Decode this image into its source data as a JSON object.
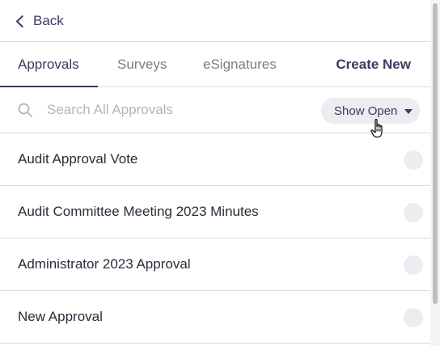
{
  "header": {
    "back_label": "Back"
  },
  "tabs": [
    {
      "label": "Approvals",
      "active": true
    },
    {
      "label": "Surveys",
      "active": false
    },
    {
      "label": "eSignatures",
      "active": false
    }
  ],
  "create_new_label": "Create New",
  "search": {
    "placeholder": "Search All Approvals",
    "value": ""
  },
  "filter": {
    "label": "Show Open"
  },
  "approvals": [
    {
      "title": "Audit Approval Vote"
    },
    {
      "title": "Audit Committee Meeting 2023 Minutes"
    },
    {
      "title": "Administrator 2023 Approval"
    },
    {
      "title": "New Approval"
    }
  ],
  "colors": {
    "accent": "#41365e",
    "divider": "#dcdce2",
    "pill_bg": "#ececf1",
    "placeholder": "#b4b4bc"
  },
  "icons": {
    "back": "chevron-left-icon",
    "search": "search-icon",
    "filter": "caret-down-icon",
    "cursor": "hand-pointer-cursor-icon",
    "status": "status-circle-icon"
  }
}
